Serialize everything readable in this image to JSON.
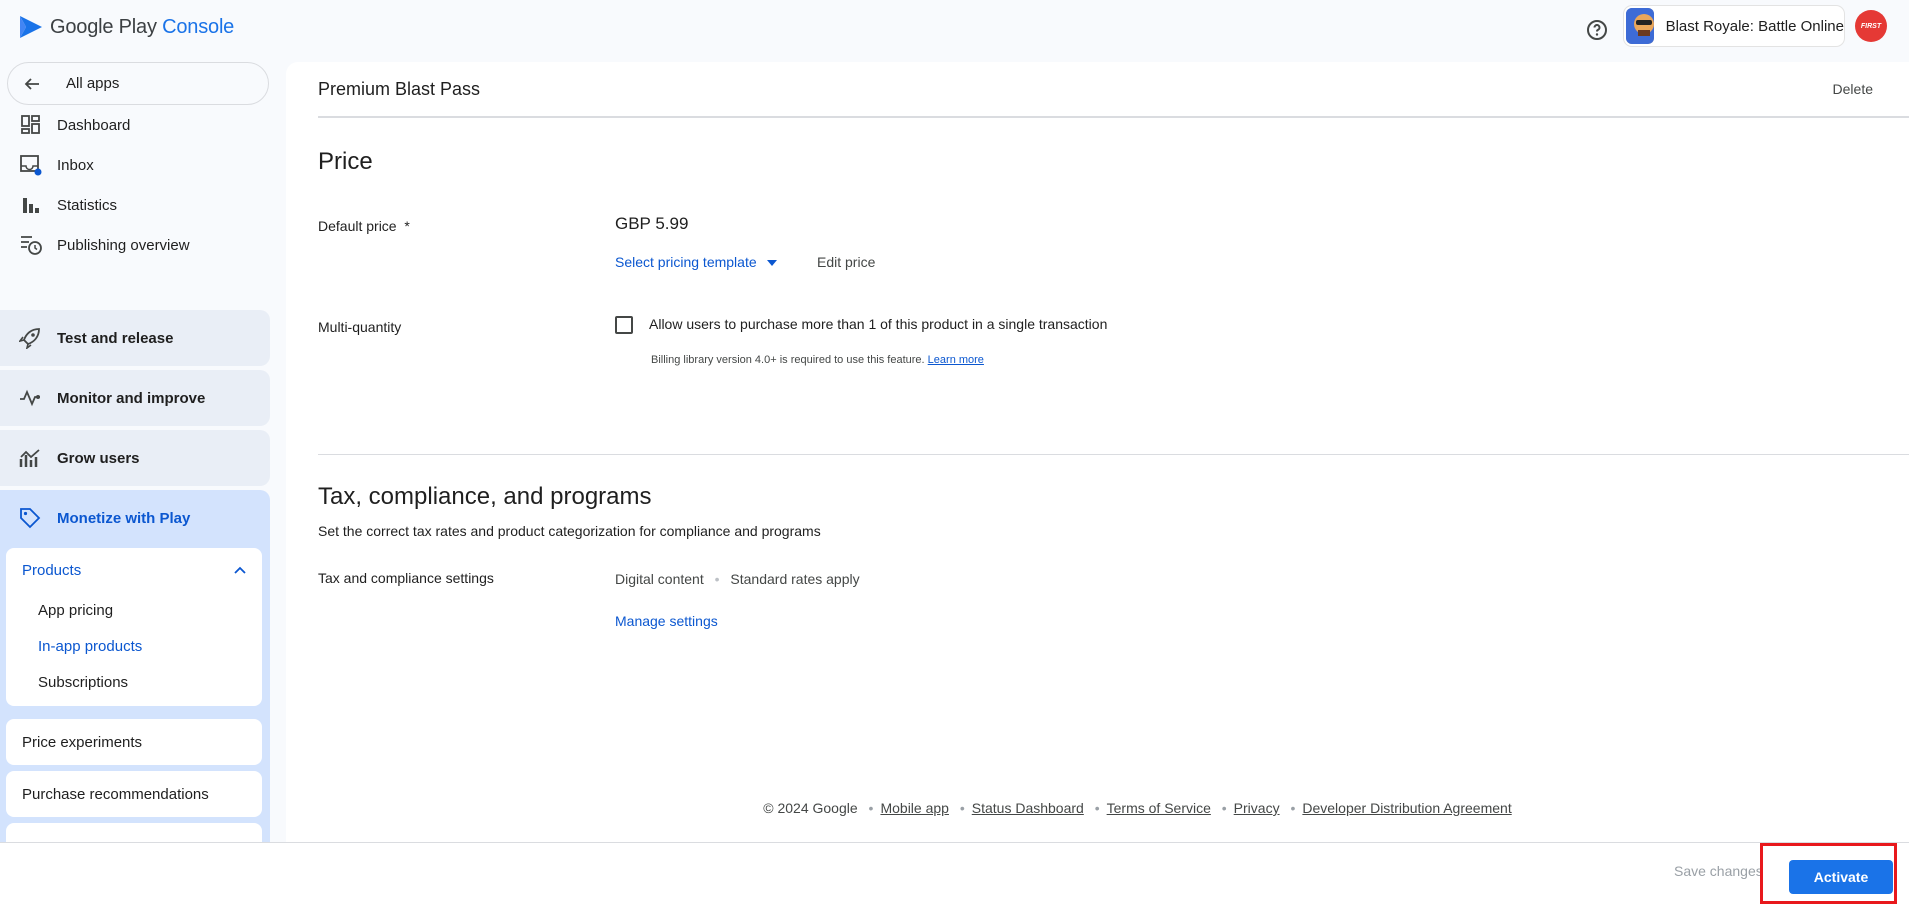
{
  "header": {
    "logo_google_play": "Google Play",
    "logo_console": "Console",
    "app_name": "Blast Royale: Battle Online",
    "avatar_text": "FIRST"
  },
  "sidebar": {
    "all_apps": "All apps",
    "items": [
      {
        "label": "Dashboard",
        "icon": "dashboard-icon"
      },
      {
        "label": "Inbox",
        "icon": "inbox-icon"
      },
      {
        "label": "Statistics",
        "icon": "bar-chart-icon"
      },
      {
        "label": "Publishing overview",
        "icon": "publishing-icon"
      }
    ],
    "groups": [
      {
        "label": "Test and release",
        "icon": "rocket-icon"
      },
      {
        "label": "Monitor and improve",
        "icon": "pulse-icon"
      },
      {
        "label": "Grow users",
        "icon": "growth-icon"
      }
    ],
    "monetize": {
      "label": "Monetize with Play",
      "products_label": "Products",
      "products_items": [
        "App pricing",
        "In-app products",
        "Subscriptions"
      ],
      "selected": "In-app products",
      "price_experiments": "Price experiments",
      "purchase_recommendations": "Purchase recommendations"
    }
  },
  "main": {
    "title": "Premium Blast Pass",
    "delete": "Delete",
    "price": {
      "section_title": "Price",
      "default_price_label": "Default price",
      "required_mark": "*",
      "value": "GBP 5.99",
      "select_template": "Select pricing template",
      "edit_price": "Edit price",
      "multi_quantity_label": "Multi-quantity",
      "checkbox_label": "Allow users to purchase more than 1 of this product in a single transaction",
      "checkbox_checked": false,
      "billing_note": "Billing library version 4.0+ is required to use this feature.",
      "learn_more": "Learn more"
    },
    "tax": {
      "section_title": "Tax, compliance, and programs",
      "subtitle": "Set the correct tax rates and product categorization for compliance and programs",
      "settings_label": "Tax and compliance settings",
      "category": "Digital content",
      "rates": "Standard rates apply",
      "manage": "Manage settings"
    },
    "footer": {
      "copyright": "© 2024 Google",
      "links": [
        "Mobile app",
        "Status Dashboard",
        "Terms of Service",
        "Privacy",
        "Developer Distribution Agreement"
      ]
    }
  },
  "bottom_bar": {
    "save_changes": "Save changes",
    "activate": "Activate"
  },
  "colors": {
    "accent": "#1a73e8",
    "active_nav_bg": "#d3e3fd",
    "group_bg": "#e9eef6",
    "highlight": "#e8181c"
  }
}
